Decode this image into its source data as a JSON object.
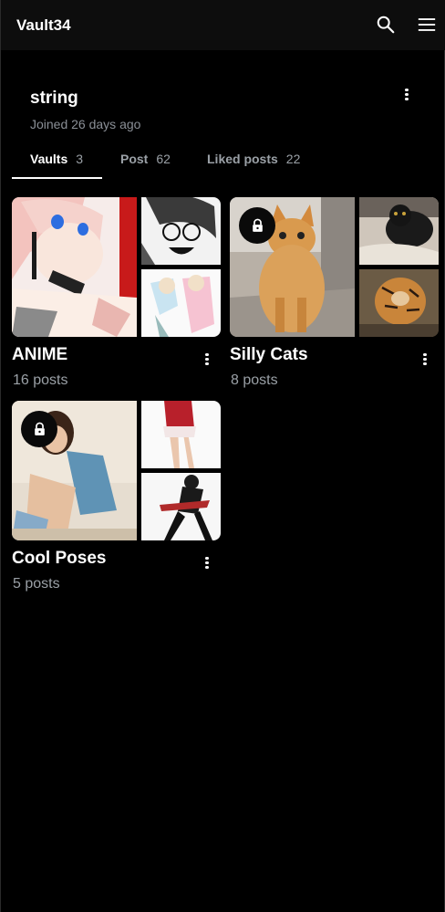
{
  "app": {
    "title": "Vault34"
  },
  "header": {
    "search_icon": "search-icon",
    "menu_icon": "hamburger-menu-icon"
  },
  "profile": {
    "name": "string",
    "joined": "Joined 26 days ago"
  },
  "tabs": [
    {
      "label": "Vaults",
      "count": "3",
      "active": true
    },
    {
      "label": "Post",
      "count": "62",
      "active": false
    },
    {
      "label": "Liked posts",
      "count": "22",
      "active": false
    }
  ],
  "vaults": [
    {
      "title": "ANIME",
      "count": "16 posts",
      "locked": false
    },
    {
      "title": "Silly Cats",
      "count": "8 posts",
      "locked": true
    },
    {
      "title": "Cool Poses",
      "count": "5 posts",
      "locked": true
    }
  ],
  "colors": {
    "background": "#000000",
    "header": "#0d0d0d",
    "muted_text": "#9aa0a6"
  }
}
